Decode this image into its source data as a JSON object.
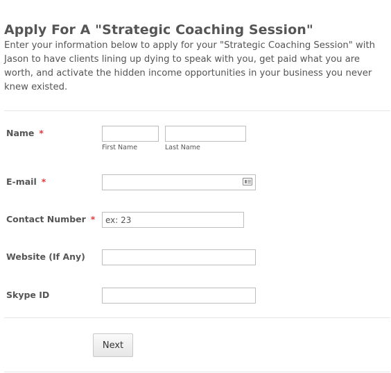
{
  "header": {
    "title": "Apply For A \"Strategic Coaching Session\"",
    "subtitle": "Enter your information below to apply for your \"Strategic Coaching Session\" with Jason to have clients lining up dying to speak with you, get paid what you are worth, and activate the hidden income opportunities in your business you never knew existed."
  },
  "fields": {
    "name": {
      "label": "Name",
      "required_marker": "*",
      "first_sublabel": "First Name",
      "last_sublabel": "Last Name",
      "first_value": "",
      "last_value": ""
    },
    "email": {
      "label": "E-mail",
      "required_marker": "*",
      "value": "",
      "icon": "contact-card-icon"
    },
    "contact": {
      "label": "Contact Number",
      "required_marker": "*",
      "value": "",
      "placeholder": "ex: 23"
    },
    "website": {
      "label": "Website (If Any)",
      "value": ""
    },
    "skype": {
      "label": "Skype ID",
      "value": ""
    }
  },
  "actions": {
    "next_label": "Next"
  },
  "colors": {
    "text": "#555555",
    "required": "#e0393e",
    "input_border": "#bdbdbd",
    "divider": "#e6e6e6"
  }
}
